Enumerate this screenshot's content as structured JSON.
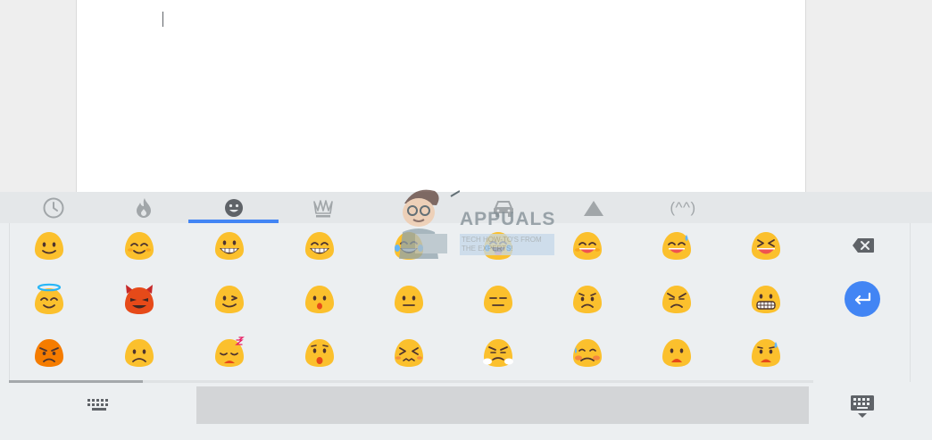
{
  "document": {
    "background": "#ffffff"
  },
  "keyboard": {
    "accent": "#4285f4",
    "categories": [
      {
        "name": "recent",
        "icon": "clock-icon"
      },
      {
        "name": "popular",
        "icon": "flame-icon"
      },
      {
        "name": "smileys",
        "icon": "smiley-icon",
        "active": true
      },
      {
        "name": "symbols",
        "icon": "crown-icon"
      },
      {
        "name": "travel",
        "icon": "car-icon"
      },
      {
        "name": "shapes",
        "icon": "triangle-icon"
      },
      {
        "name": "emoticons",
        "label": "(^^)"
      }
    ],
    "emoji_rows": [
      [
        "slightly-smiling-face",
        "smiling-face-with-smiling-eyes",
        "grinning-face",
        "grinning-face-with-smiling-eyes",
        "face-with-tears-of-joy",
        "face-with-tears-of-joy",
        "smiling-face-with-open-mouth-and-smiling-eyes",
        "smiling-face-with-open-mouth-and-cold-sweat",
        "smiling-face-with-open-mouth-and-tightly-closed-eyes"
      ],
      [
        "smiling-face-with-halo",
        "smiling-face-with-horns",
        "winking-face",
        "face-with-open-mouth",
        "neutral-face",
        "expressionless-face",
        "confused-face",
        "persevering-face",
        "grimacing-face"
      ],
      [
        "pouting-face",
        "frowning-face",
        "sleepy-face",
        "hushed-face",
        "confounded-face",
        "face-with-look-of-triumph",
        "disappointed-but-relieved-face",
        "anguished-face",
        "face-with-open-mouth-and-cold-sweat"
      ]
    ],
    "side_keys": {
      "backspace_icon": "backspace-icon",
      "enter_icon": "enter-icon"
    },
    "bottom": {
      "keyboard_switch_icon": "keyboard-icon",
      "hide_keyboard_icon": "keyboard-hide-icon"
    }
  },
  "watermark": {
    "title": "APPUALS",
    "subtitle": "TECH HOW-TO'S FROM THE EXPERTS!"
  }
}
